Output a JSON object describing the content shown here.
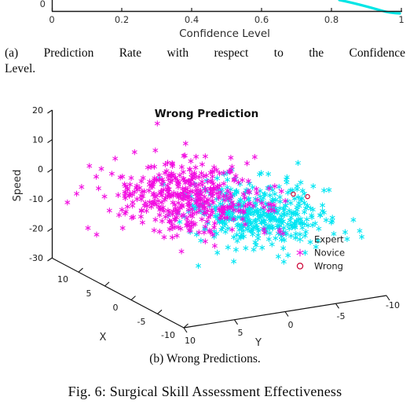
{
  "figure_a": {
    "name": "prediction-rate-chart",
    "xlabel": "Confidence Level",
    "x_ticks": [
      "0",
      "0.2",
      "0.4",
      "0.6",
      "0.8",
      "1"
    ],
    "y_ticks_visible": [
      "0"
    ],
    "curve_color": "#00e5e5",
    "note_clipped": "top of plot cropped out of frame"
  },
  "caption_a": {
    "line1": "(a) Prediction Rate with respect to the Confidence",
    "line2": "Level."
  },
  "figure_b": {
    "title": "Wrong Prediction",
    "zlabel": "Speed",
    "xlabel": "X",
    "ylabel": "Y",
    "z_ticks": [
      "20",
      "10",
      "0",
      "-10",
      "-20",
      "-30"
    ],
    "x_ticks": [
      "10",
      "5",
      "0",
      "-5",
      "-10"
    ],
    "y_ticks": [
      "10",
      "5",
      "0",
      "-5",
      "-10"
    ],
    "legend": [
      {
        "label": "Expert",
        "marker": "asterisk",
        "color": "#00e5f2"
      },
      {
        "label": "Novice",
        "marker": "asterisk",
        "color": "#f20ce0"
      },
      {
        "label": "Wrong",
        "marker": "circle",
        "color": "#cc0033"
      }
    ]
  },
  "caption_b": {
    "text": "(b) Wrong Predictions."
  },
  "figure_caption": {
    "text": "Fig. 6: Surgical Skill Assessment Effectiveness"
  },
  "chart_data": [
    {
      "type": "line",
      "title": "",
      "xlabel": "Confidence Level",
      "ylabel": "",
      "xlim": [
        0,
        1
      ],
      "ylim": [
        0,
        1
      ],
      "grid": false,
      "legend_position": "none",
      "xticks": [
        0,
        0.2,
        0.4,
        0.6,
        0.8,
        1
      ],
      "yticks_visible": [
        0
      ],
      "series": [
        {
          "name": "Prediction Rate",
          "color": "#00e5e5",
          "x": [
            0.86,
            0.89,
            0.92,
            0.94,
            0.96,
            0.975,
            0.985,
            0.993,
            1.0
          ],
          "y": [
            0.16,
            0.145,
            0.125,
            0.105,
            0.08,
            0.055,
            0.035,
            0.018,
            0.01
          ]
        }
      ],
      "note": "only the bottom sliver of this plot is visible; curve descends toward the axis near x=1"
    },
    {
      "type": "scatter",
      "title": "Wrong Prediction",
      "projection": "3d",
      "xlabel": "X",
      "ylabel": "Y",
      "zlabel": "Speed",
      "xlim": [
        -10,
        10
      ],
      "ylim": [
        -10,
        10
      ],
      "zlim": [
        -30,
        20
      ],
      "xticks": [
        10,
        5,
        0,
        -5,
        -10
      ],
      "yticks": [
        10,
        5,
        0,
        -5,
        -10
      ],
      "zticks": [
        20,
        10,
        0,
        -10,
        -20,
        -30
      ],
      "grid": false,
      "legend_position": "lower-right",
      "series": [
        {
          "name": "Expert",
          "color": "#00e5f2",
          "marker": "*",
          "approx_count": 420,
          "cluster_center_xyz": [
            -1.5,
            -3.0,
            -9.0
          ],
          "cluster_spread_xyz": [
            5.0,
            4.5,
            7.0
          ]
        },
        {
          "name": "Novice",
          "color": "#f20ce0",
          "marker": "*",
          "approx_count": 430,
          "cluster_center_xyz": [
            2.5,
            1.5,
            -5.0
          ],
          "cluster_spread_xyz": [
            5.5,
            5.0,
            8.0
          ]
        },
        {
          "name": "Wrong",
          "color": "#cc0033",
          "marker": "o",
          "approx_count": 2,
          "cluster_center_xyz": [
            -3.0,
            -5.0,
            -1.0
          ],
          "cluster_spread_xyz": [
            1.0,
            1.0,
            1.0
          ]
        }
      ]
    }
  ]
}
